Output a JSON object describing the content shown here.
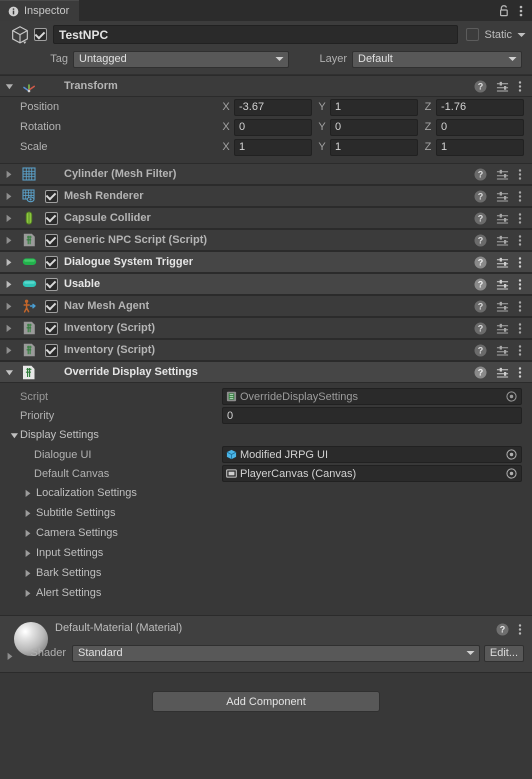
{
  "window": {
    "tab_label": "Inspector",
    "tab_icon": "info-icon",
    "lock_icon": "lock-icon",
    "menu_icon": "kebab-menu-icon"
  },
  "gameobject": {
    "enabled": true,
    "icon": "cube-icon",
    "name": "TestNPC",
    "static_label": "Static",
    "static_checked": false,
    "tag_label": "Tag",
    "tag_value": "Untagged",
    "layer_label": "Layer",
    "layer_value": "Default"
  },
  "transform": {
    "title": "Transform",
    "icon": "transform-axis-icon",
    "expanded": true,
    "rows": [
      {
        "label": "Position",
        "x": "-3.67",
        "y": "1",
        "z": "-1.76"
      },
      {
        "label": "Rotation",
        "x": "0",
        "y": "0",
        "z": "0"
      },
      {
        "label": "Scale",
        "x": "1",
        "y": "1",
        "z": "1"
      }
    ],
    "axis_labels": {
      "x": "X",
      "y": "Y",
      "z": "Z"
    }
  },
  "components": [
    {
      "title": "Cylinder (Mesh Filter)",
      "icon": "mesh-filter-icon",
      "icon_color": "#5aa0c8",
      "has_checkbox": false,
      "checked": false,
      "row_style": "dark",
      "bold_title": false
    },
    {
      "title": "Mesh Renderer",
      "icon": "mesh-renderer-icon",
      "icon_color": "#5aa0c8",
      "has_checkbox": true,
      "checked": true,
      "row_style": "dark",
      "bold_title": false
    },
    {
      "title": "Capsule Collider",
      "icon": "capsule-collider-icon",
      "icon_color": "#8cc63f",
      "has_checkbox": true,
      "checked": true,
      "row_style": "dark",
      "bold_title": false
    },
    {
      "title": "Generic NPC Script (Script)",
      "icon": "script-icon",
      "icon_color": "#9a9a9a",
      "has_checkbox": true,
      "checked": true,
      "row_style": "dark",
      "bold_title": false
    },
    {
      "title": "Dialogue System Trigger",
      "icon": "capsule-green-icon",
      "icon_color": "#22b14c",
      "has_checkbox": true,
      "checked": true,
      "row_style": "light",
      "bold_title": true
    },
    {
      "title": "Usable",
      "icon": "capsule-teal-icon",
      "icon_color": "#2ec4b6",
      "has_checkbox": true,
      "checked": true,
      "row_style": "light",
      "bold_title": true
    },
    {
      "title": "Nav Mesh Agent",
      "icon": "nav-mesh-agent-icon",
      "icon_color": "#c4662a",
      "has_checkbox": true,
      "checked": true,
      "row_style": "dark",
      "bold_title": false
    },
    {
      "title": "Inventory (Script)",
      "icon": "script-icon",
      "icon_color": "#9a9a9a",
      "has_checkbox": true,
      "checked": true,
      "row_style": "dark",
      "bold_title": false
    },
    {
      "title": "Inventory (Script)",
      "icon": "script-icon",
      "icon_color": "#9a9a9a",
      "has_checkbox": true,
      "checked": true,
      "row_style": "dark",
      "bold_title": false
    }
  ],
  "row_icons": {
    "help": "help-icon",
    "preset": "preset-sliders-icon",
    "menu": "kebab-menu-icon"
  },
  "override_display_settings": {
    "title": "Override Display Settings",
    "icon": "script-icon",
    "expanded": true,
    "script_label": "Script",
    "script_value": "OverrideDisplaySettings",
    "script_icon": "script-asset-icon",
    "priority_label": "Priority",
    "priority_value": "0",
    "display_settings_label": "Display Settings",
    "display_settings_expanded": true,
    "dialogue_ui_label": "Dialogue UI",
    "dialogue_ui_value": "Modified JRPG UI",
    "dialogue_ui_icon": "prefab-icon",
    "default_canvas_label": "Default Canvas",
    "default_canvas_value": "PlayerCanvas (Canvas)",
    "default_canvas_icon": "canvas-icon",
    "subfoldouts": [
      "Localization Settings",
      "Subtitle Settings",
      "Camera Settings",
      "Input Settings",
      "Bark Settings",
      "Alert Settings"
    ]
  },
  "material": {
    "title": "Default-Material (Material)",
    "preview_icon": "material-sphere-icon",
    "shader_label": "Shader",
    "shader_value": "Standard",
    "edit_label": "Edit...",
    "help_icon": "help-icon",
    "menu_icon": "kebab-menu-icon"
  },
  "footer": {
    "add_component_label": "Add Component"
  },
  "colors": {
    "background": "#383838",
    "header": "#3c3c3c",
    "row_dark": "#3b3b3b",
    "row_light": "#464646",
    "field": "#2a2a2a",
    "button": "#585858",
    "text": "#c4c4c4"
  }
}
